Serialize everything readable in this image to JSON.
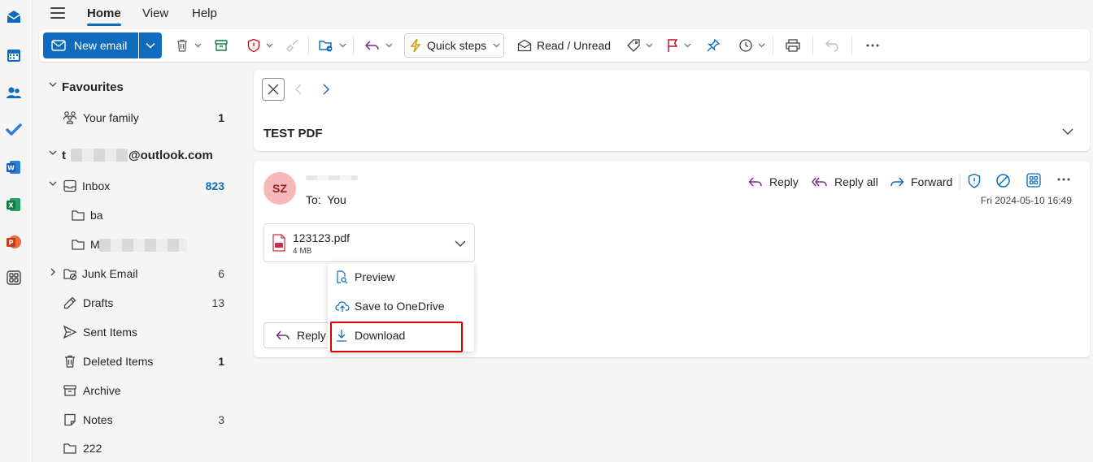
{
  "menu_tabs": [
    "Home",
    "View",
    "Help"
  ],
  "ribbon": {
    "new_email": "New email",
    "quick_steps": "Quick steps",
    "read_unread": "Read / Unread"
  },
  "folders": {
    "favourites_header": "Favourites",
    "favourites": [
      {
        "name": "Your family",
        "count": "1"
      }
    ],
    "account_prefix": "t",
    "account_suffix": "@outlook.com",
    "inbox": {
      "name": "Inbox",
      "count": "823"
    },
    "inbox_subfolders": [
      {
        "name": "ba"
      },
      {
        "name": "M"
      }
    ],
    "junk": {
      "name": "Junk Email",
      "count": "6"
    },
    "drafts": {
      "name": "Drafts",
      "count": "13"
    },
    "sent": {
      "name": "Sent Items"
    },
    "deleted": {
      "name": "Deleted Items",
      "count": "1"
    },
    "archive": {
      "name": "Archive"
    },
    "notes": {
      "name": "Notes",
      "count": "3"
    },
    "custom": {
      "name": "222"
    }
  },
  "message": {
    "subject": "TEST PDF",
    "sender_initials": "SZ",
    "to_label": "To:",
    "to_value": "You",
    "date": "Fri 2024-05-10 16:49",
    "actions": {
      "reply": "Reply",
      "reply_all": "Reply all",
      "forward": "Forward"
    },
    "attachment": {
      "name": "123123.pdf",
      "size": "4 MB"
    },
    "reply_button": "Reply"
  },
  "attachment_menu": {
    "items": [
      {
        "label": "Preview"
      },
      {
        "label": "Save to OneDrive"
      },
      {
        "label": "Download"
      }
    ]
  },
  "colors": {
    "accent": "#0f6cbd",
    "avatar_bg": "#f4b8b8",
    "highlight": "#e00000"
  }
}
